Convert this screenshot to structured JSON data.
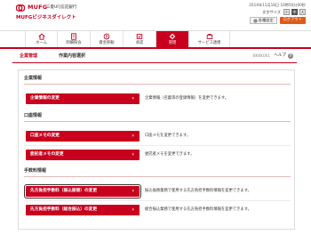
{
  "brand": {
    "logo_text": "MUFG",
    "bank_name": "三菱UFJ信託銀行",
    "app_name": "MUFGビジネスダイレクト",
    "accent_color": "#c8001e"
  },
  "header": {
    "timestamp": "2014年11月18日 10時50分00秒",
    "font_size_label": "文字サイズ",
    "font_sizes": [
      "小",
      "中",
      "大"
    ],
    "settings_label": "各種設定",
    "logout_label": "ログアウト"
  },
  "global_nav": {
    "items": [
      {
        "label": "ホーム",
        "icon": "home-icon"
      },
      {
        "label": "明細照会",
        "icon": "statement-icon"
      },
      {
        "label": "資金移動",
        "icon": "transfer-icon"
      },
      {
        "label": "承認",
        "icon": "approval-icon"
      },
      {
        "label": "管理",
        "icon": "admin-icon",
        "active": true
      },
      {
        "label": "サービス連携",
        "icon": "service-link-icon"
      }
    ]
  },
  "page": {
    "category": "企業管理",
    "title": "作業内容選択",
    "code": "BKKK001",
    "help_label": "ヘルプ",
    "help_icon": "help-icon"
  },
  "sections": [
    {
      "heading": "企業情報",
      "items": [
        {
          "button": "企業情報の変更",
          "desc": "企業情報（名義等の登録情報）を変更できます。"
        }
      ]
    },
    {
      "heading": "口座情報",
      "items": [
        {
          "button": "口座メモの変更",
          "desc": "口座メモを変更できます。"
        },
        {
          "button": "委託者メモの変更",
          "desc": "委託者メモを変更できます。"
        }
      ]
    },
    {
      "heading": "手数料情報",
      "items": [
        {
          "button": "先方負担手数料（振込振替）の変更",
          "desc": "振込振替業務で使用する先方負担手数料情報を変更できます。"
        },
        {
          "button": "先方負担手数料（総合振込）の変更",
          "desc": "総合振込業務で使用する先方負担手数料情報を変更できます。"
        }
      ]
    }
  ]
}
